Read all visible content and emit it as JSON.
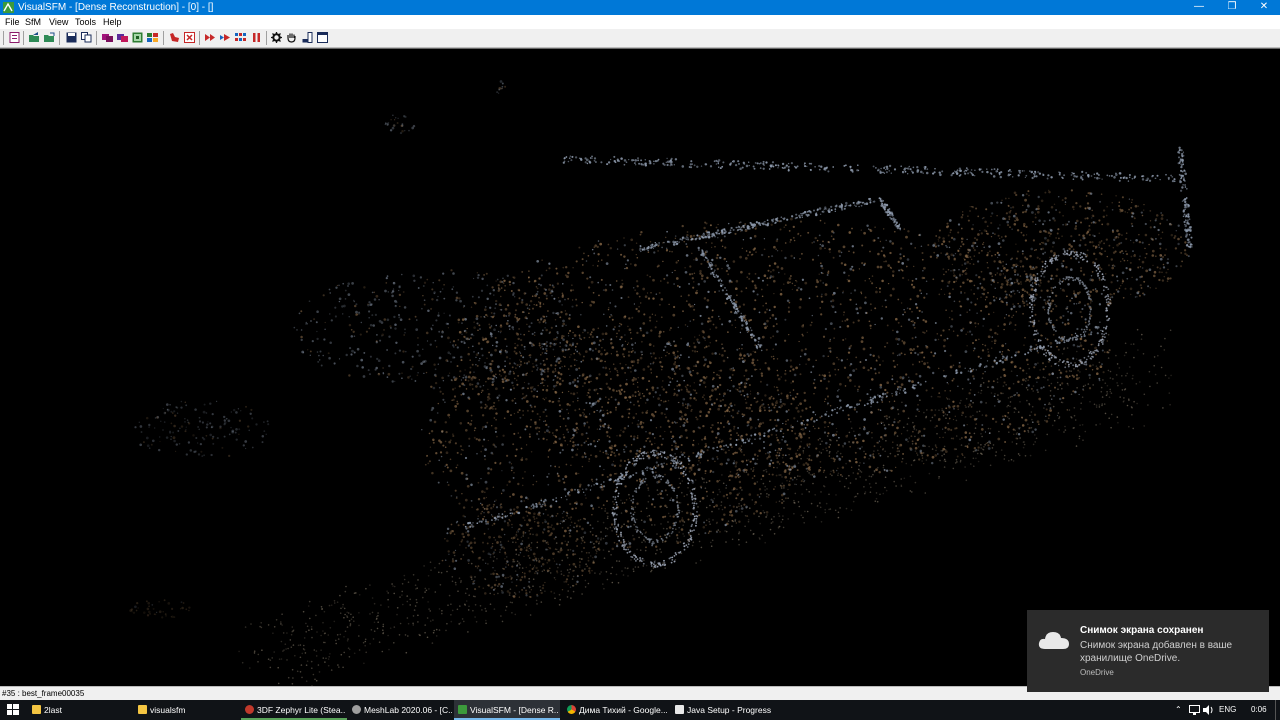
{
  "window": {
    "title": "VisualSFM - [Dense Reconstruction] - [0] - []",
    "minimize_glyph": "—",
    "maximize_glyph": "❐",
    "close_glyph": "✕"
  },
  "menu": [
    "File",
    "SfM",
    "View",
    "Tools",
    "Help"
  ],
  "toolbar_icons": [
    "new-workspace-icon",
    "open-multi-images-icon",
    "open-workspace-icon",
    "save-icon",
    "copy-icon",
    "compute-missing-matches-icon",
    "compute-sfm-icon",
    "match-view-icon",
    "show-features-icon",
    "remove-icon",
    "close-icon",
    "reconstruct-sparse-icon",
    "reconstruct-resume-icon",
    "dense-icon",
    "pause-icon",
    "settings-gear-icon",
    "pan-hand-icon",
    "show-log-icon",
    "window-toggle-icon"
  ],
  "status": {
    "text": "#35 : best_frame00035"
  },
  "taskbar": {
    "items": [
      {
        "label": "2last",
        "icon": "folder-icon",
        "active": false
      },
      {
        "label": "visualsfm",
        "icon": "folder-icon",
        "active": false
      },
      {
        "label": "3DF Zephyr Lite (Stea...",
        "icon": "zephyr-icon",
        "active": false
      },
      {
        "label": "MeshLab 2020.06 - [C...",
        "icon": "meshlab-icon",
        "active": false
      },
      {
        "label": "VisualSFM - [Dense R...",
        "icon": "visualsfm-icon",
        "active": true
      },
      {
        "label": "Дима Тихий - Google...",
        "icon": "chrome-icon",
        "active": false
      },
      {
        "label": "Java Setup - Progress",
        "icon": "java-icon",
        "active": false
      }
    ],
    "tray": {
      "chevron": "⌃",
      "language": "ENG",
      "time": "0:06"
    }
  },
  "toast": {
    "title": "Снимок экрана сохранен",
    "body": "Снимок экрана добавлен в ваше хранилище OneDrive.",
    "source": "OneDrive"
  },
  "colors": {
    "titlebar": "#0078d7",
    "viewport_bg": "#000000",
    "taskbar": "#101317",
    "toast_bg": "#2b2b2b",
    "point_warm": "#8a6a48",
    "point_cool": "#8a96a8"
  }
}
